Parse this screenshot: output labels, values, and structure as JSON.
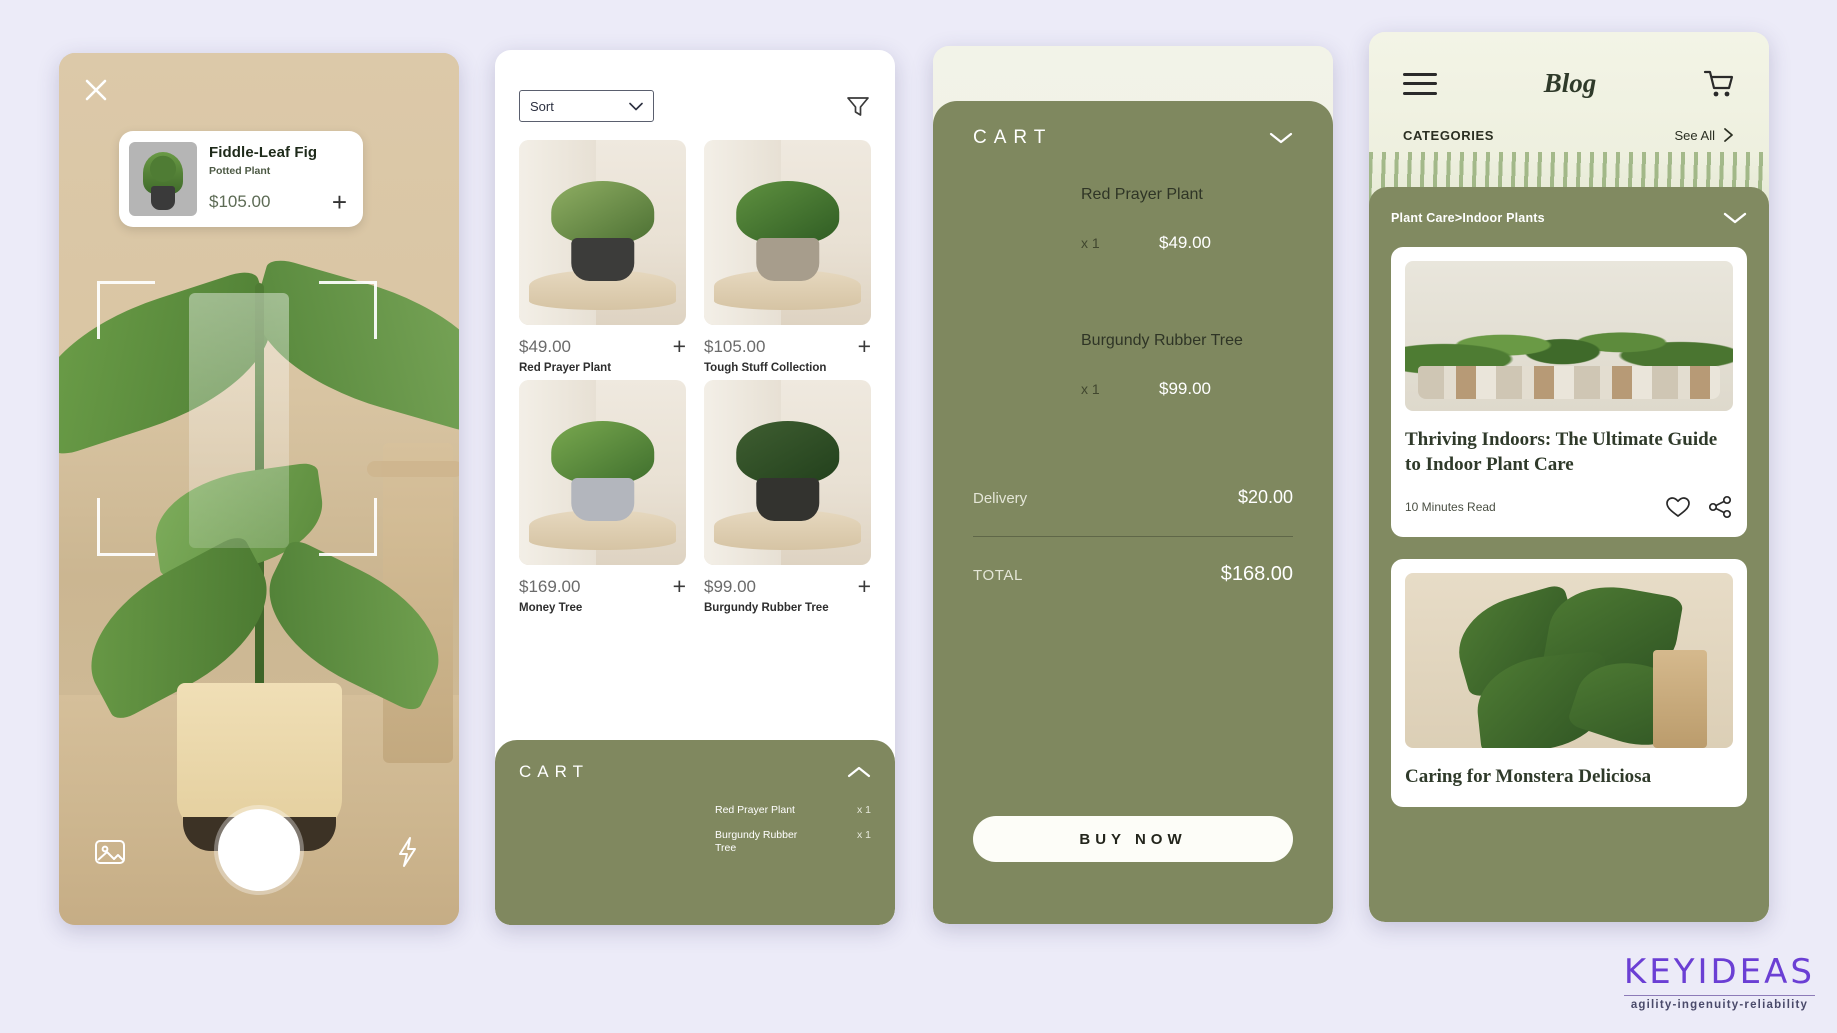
{
  "screen_ar": {
    "close_icon": "close-icon",
    "product": {
      "title": "Fiddle-Leaf Fig",
      "subtitle": "Potted Plant",
      "price": "$105.00",
      "add_label": "+"
    },
    "controls": {
      "gallery_icon": "gallery-icon",
      "shutter": "shutter-button",
      "flash_icon": "flash-icon"
    }
  },
  "screen_listing": {
    "sort_label": "Sort",
    "filter_icon": "filter-icon",
    "products": [
      {
        "price": "$49.00",
        "name": "Red Prayer Plant",
        "add": "+"
      },
      {
        "price": "$105.00",
        "name": "Tough Stuff Collection",
        "add": "+"
      },
      {
        "price": "$169.00",
        "name": "Money Tree",
        "add": "+"
      },
      {
        "price": "$99.00",
        "name": "Burgundy Rubber Tree",
        "add": "+"
      }
    ],
    "cart_drawer": {
      "label": "CART",
      "items": [
        {
          "name": "Red Prayer Plant",
          "qty": "x 1"
        },
        {
          "name": "Burgundy Rubber Tree",
          "qty": "x 1"
        }
      ]
    }
  },
  "screen_cart": {
    "label": "CART",
    "items": [
      {
        "name": "Red Prayer Plant",
        "qty": "x 1",
        "price": "$49.00"
      },
      {
        "name": "Burgundy Rubber Tree",
        "qty": "x 1",
        "price": "$99.00"
      }
    ],
    "delivery_label": "Delivery",
    "delivery_value": "$20.00",
    "total_label": "TOTAL",
    "total_value": "$168.00",
    "buy_label": "BUY NOW"
  },
  "screen_blog": {
    "menu_icon": "hamburger-icon",
    "title": "Blog",
    "cart_icon": "shopping-cart-icon",
    "categories_label": "CATEGORIES",
    "see_all_label": "See All",
    "breadcrumb": "Plant Care>Indoor Plants",
    "articles": [
      {
        "title": "Thriving Indoors: The Ultimate Guide to Indoor Plant Care",
        "read_time": "10 Minutes Read",
        "like_icon": "heart-icon",
        "share_icon": "share-icon"
      },
      {
        "title": "Caring for Monstera Deliciosa"
      }
    ]
  },
  "logo": {
    "name": "KEYIDEAS",
    "tagline": "agility-ingenuity-reliability"
  },
  "colors": {
    "background": "#ecebf8",
    "olive": "#80885f",
    "olive_dark": "#7f885f",
    "brand_purple": "#6b3fd4"
  }
}
